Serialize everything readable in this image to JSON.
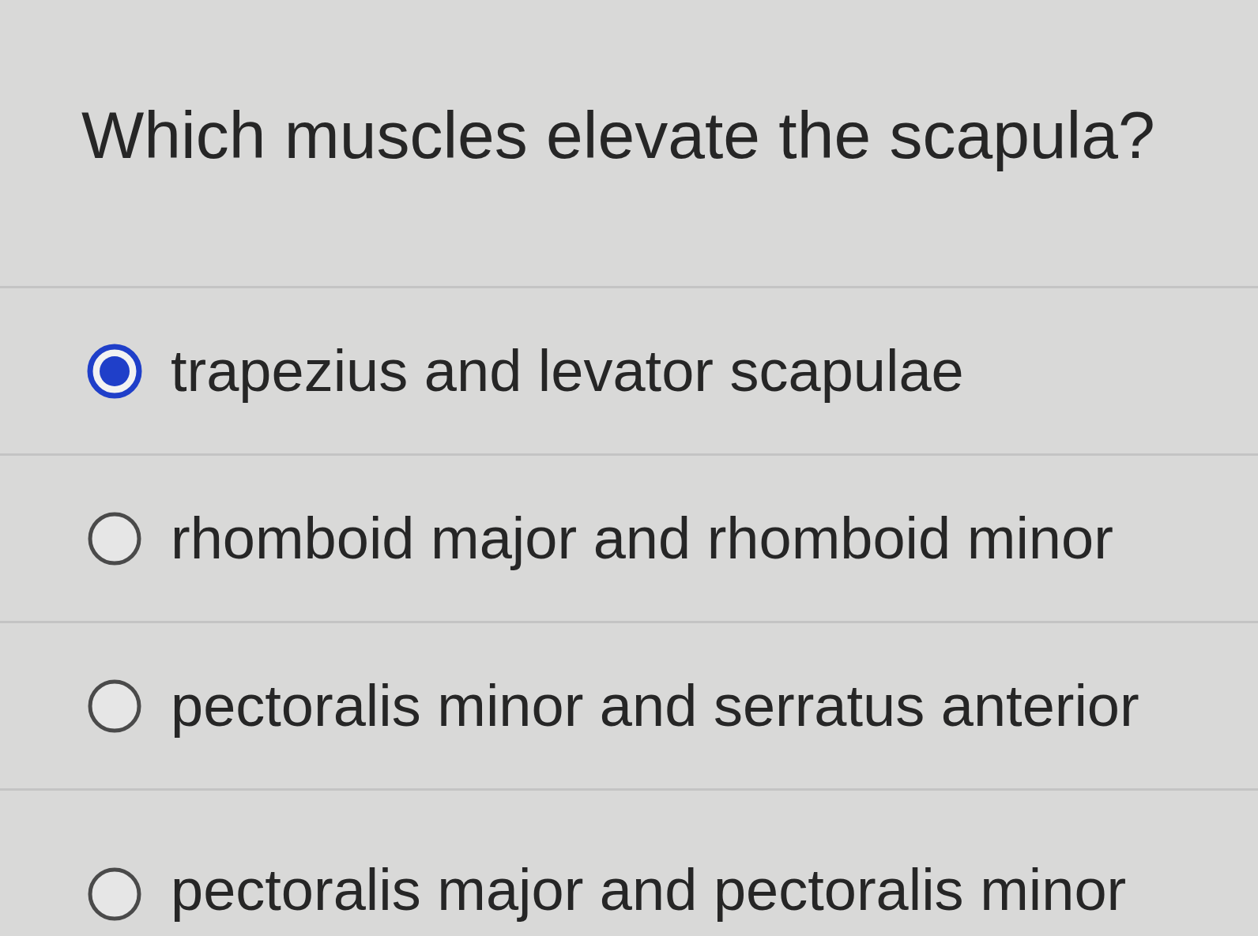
{
  "question": "Which muscles elevate the scapula?",
  "options": [
    {
      "label": "trapezius and levator scapulae",
      "selected": true
    },
    {
      "label": "rhomboid major and rhomboid minor",
      "selected": false
    },
    {
      "label": "pectoralis minor and serratus anterior",
      "selected": false
    },
    {
      "label": "pectoralis major and pectoralis minor",
      "selected": false
    }
  ]
}
